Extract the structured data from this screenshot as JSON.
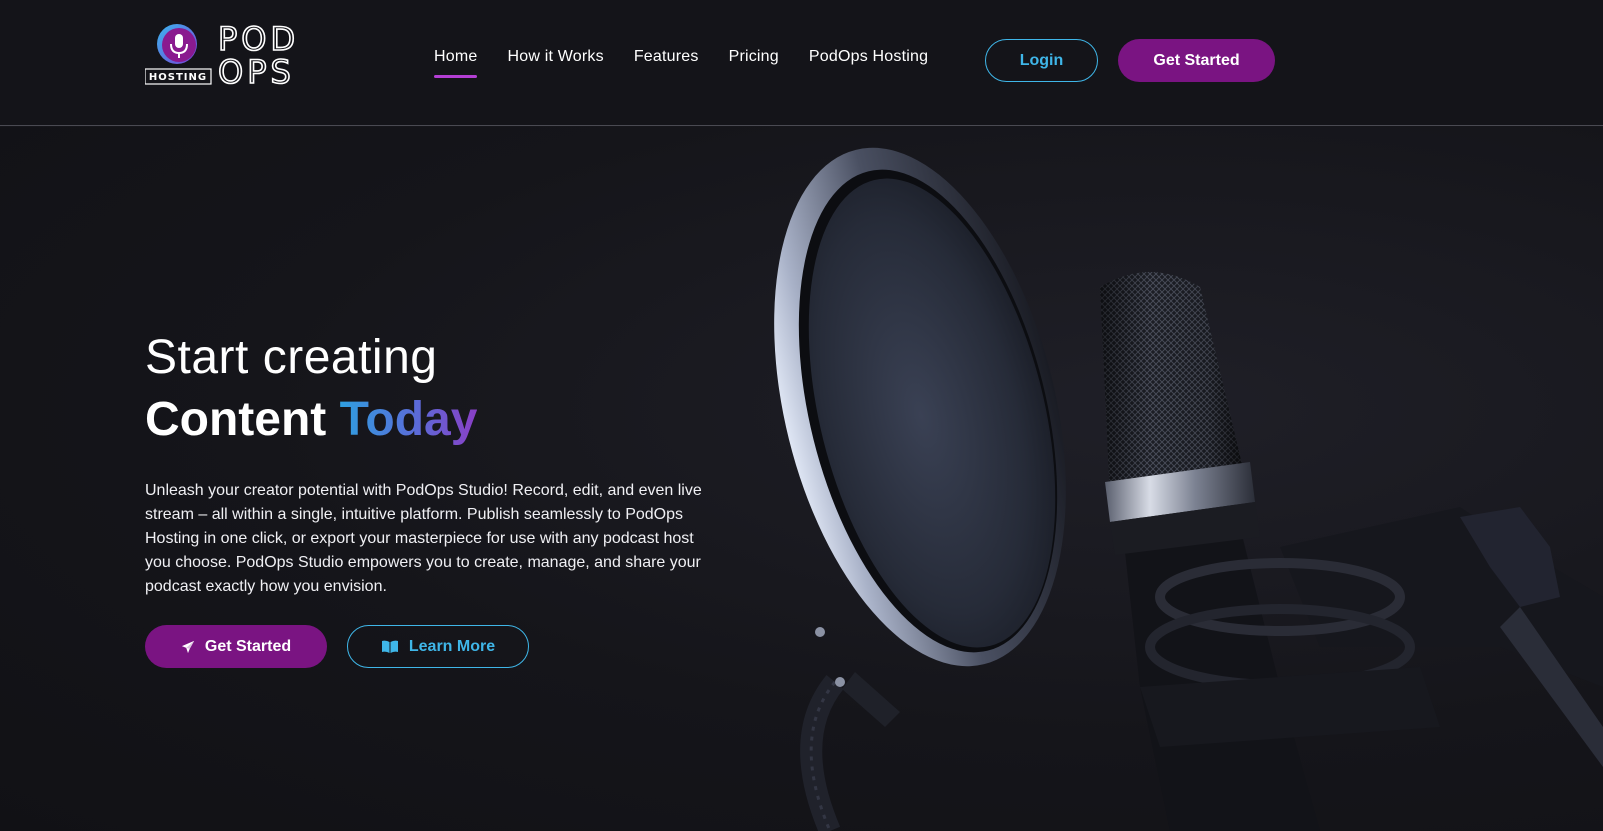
{
  "header": {
    "logo": {
      "wordmark_top": "POD",
      "wordmark_bottom": "OPS",
      "badge": "HOSTING",
      "icon": "microphone-icon"
    },
    "nav": [
      {
        "label": "Home",
        "active": true
      },
      {
        "label": "How it Works",
        "active": false
      },
      {
        "label": "Features",
        "active": false
      },
      {
        "label": "Pricing",
        "active": false
      },
      {
        "label": "PodOps Hosting",
        "active": false
      }
    ],
    "login_label": "Login",
    "get_started_label": "Get Started"
  },
  "hero": {
    "headline_line1": "Start creating",
    "headline_line2_plain": "Content",
    "headline_line2_accent": "Today",
    "description": "Unleash your creator potential with PodOps Studio! Record, edit, and even live stream – all within a single, intuitive platform. Publish seamlessly to PodOps Hosting in one click, or export your masterpiece for use with any podcast host you choose. PodOps Studio empowers you to create, manage, and share your podcast exactly how you envision.",
    "primary_button": {
      "label": "Get Started",
      "icon": "paper-plane-icon"
    },
    "secondary_button": {
      "label": "Learn More",
      "icon": "open-book-icon"
    },
    "image": "studio-microphone-with-pop-filter"
  },
  "colors": {
    "background": "#16161b",
    "brand_purple": "#7a1482",
    "accent_blue": "#3fb6e8",
    "nav_underline": "#b43fd4"
  }
}
